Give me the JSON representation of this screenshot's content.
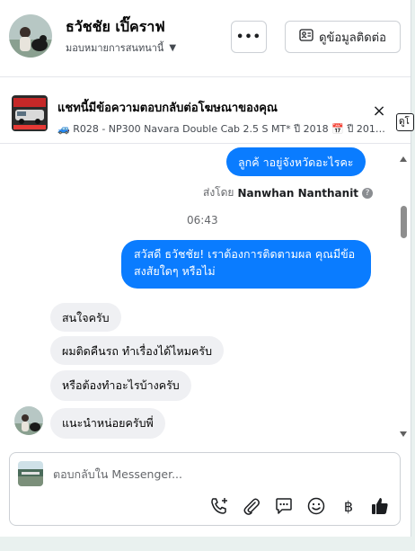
{
  "header": {
    "contact_name": "ธวัชชัย เปิ๊คราฟ",
    "assignee_label": "มอบหมายการสนทนานี้",
    "more_label": "•••",
    "contact_info_label": "ดูข้อมูลติดต่อ"
  },
  "ad_banner": {
    "title": "แชทนี้มีข้อความตอบกลับต่อโฆษณาของคุณ",
    "subtitle": "🚙 R028 - NP300 Navara Double Cab 2.5 S MT* ปี 2018 📅 ปี 201…",
    "close_icon": "×",
    "link_tab": "ดูโ"
  },
  "messages": {
    "out_1": "ลูกค้ าอยู่จังหวัดอะไรคะ",
    "sent_by_prefix": "ส่งโดย",
    "sent_by_name": "Nanwhan Nanthanit",
    "info_icon": "?",
    "timestamp": "06:43",
    "out_2": "สวัสดี ธวัชชัย! เราต้องการติดตามผล คุณมีข้อสงสัยใดๆ หรือไม่",
    "in_1": "สนใจครับ",
    "in_2": "ผมติดคืนรถ ทำเรื่องได้ไหมครับ",
    "in_3": "หรือต้องทำอะไรบ้างครับ",
    "in_4": "แนะนำหน่อยครับพี่"
  },
  "composer": {
    "placeholder": "ตอบกลับใน Messenger...",
    "currency_symbol": "฿",
    "tools": [
      "call-add-icon",
      "paperclip-icon",
      "saved-reply-icon",
      "emoji-icon",
      "baht-icon",
      "like-icon"
    ]
  },
  "colors": {
    "outgoing_bubble": "#0a7cff",
    "incoming_bubble": "#eff0f3",
    "like_icon": "#1c1e21"
  }
}
